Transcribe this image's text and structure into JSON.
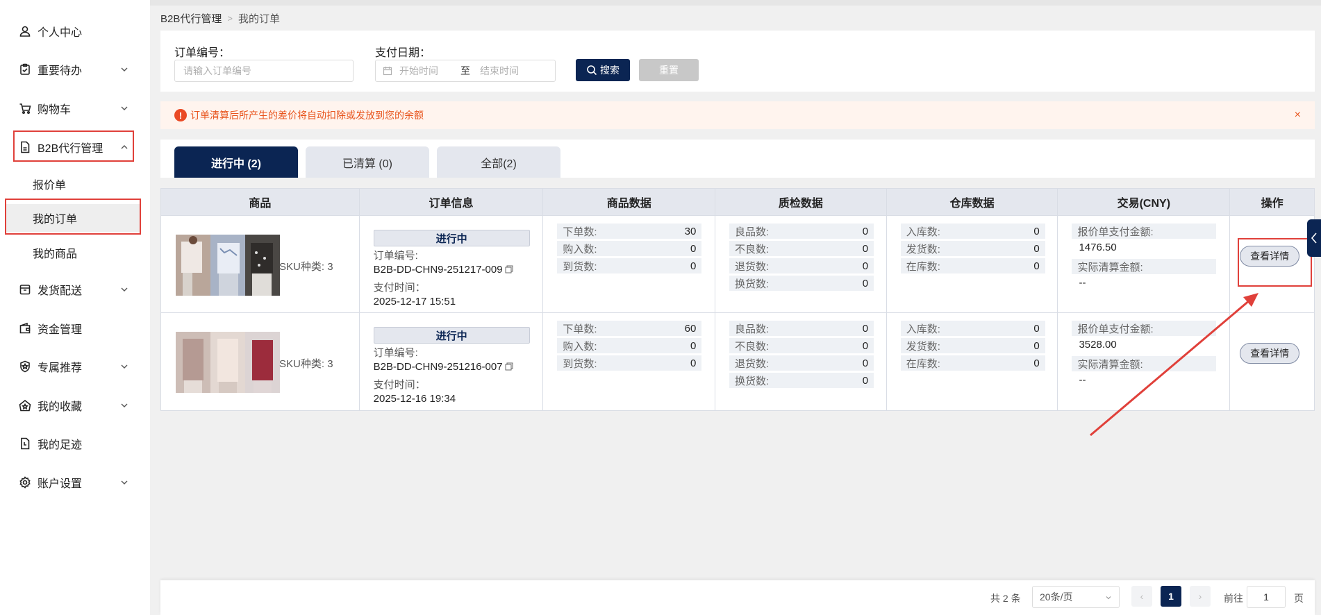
{
  "sidebar": {
    "items": [
      {
        "label": "个人中心",
        "icon": "user-icon"
      },
      {
        "label": "重要待办",
        "icon": "clipboard-icon"
      },
      {
        "label": "购物车",
        "icon": "cart-icon"
      },
      {
        "label": "B2B代行管理",
        "icon": "document-icon",
        "expanded": true,
        "children": [
          "报价单",
          "我的订单",
          "我的商品"
        ],
        "active_child": "我的订单"
      },
      {
        "label": "发货配送",
        "icon": "shipping-icon"
      },
      {
        "label": "资金管理",
        "icon": "wallet-icon"
      },
      {
        "label": "专属推荐",
        "icon": "badge-icon"
      },
      {
        "label": "我的收藏",
        "icon": "star-icon"
      },
      {
        "label": "我的足迹",
        "icon": "history-icon"
      },
      {
        "label": "账户设置",
        "icon": "gear-icon"
      }
    ]
  },
  "breadcrumb": {
    "parent": "B2B代行管理",
    "current": "我的订单"
  },
  "search": {
    "order_no_label": "订单编号：",
    "order_no_placeholder": "请输入订单编号",
    "pay_date_label": "支付日期：",
    "start_placeholder": "开始时间",
    "range_sep": "至",
    "end_placeholder": "结束时间",
    "search_btn": "搜索",
    "reset_btn": "重置"
  },
  "alert": {
    "text": "订单清算后所产生的差价将自动扣除或发放到您的余额",
    "close": "×"
  },
  "tabs": [
    {
      "label": "进行中 (2)",
      "active": true
    },
    {
      "label": "已清算 (0)",
      "active": false
    },
    {
      "label": "全部(2)",
      "active": false
    }
  ],
  "table": {
    "headers": [
      "商品",
      "订单信息",
      "商品数据",
      "质检数据",
      "仓库数据",
      "交易(CNY)",
      "操作"
    ],
    "labels": {
      "sku": "SKU种类:",
      "order_no": "订单编号:",
      "pay_time": "支付时间：",
      "goods": [
        "下单数:",
        "购入数:",
        "到货数:"
      ],
      "qc": [
        "良品数:",
        "不良数:",
        "退货数:",
        "换货数:"
      ],
      "warehouse": [
        "入库数:",
        "发货数:",
        "在库数:"
      ],
      "quote_amount": "报价单支付金额:",
      "settle_amount": "实际清算金额:",
      "detail_btn": "查看详情"
    },
    "rows": [
      {
        "sku_count": "3",
        "status": "进行中",
        "order_no": "B2B-DD-CHN9-251217-009",
        "pay_time": "2025-12-17 15:51",
        "goods": [
          "30",
          "0",
          "0"
        ],
        "qc": [
          "0",
          "0",
          "0",
          "0"
        ],
        "warehouse": [
          "0",
          "0",
          "0"
        ],
        "quote_amount": "1476.50",
        "settle_amount": "--"
      },
      {
        "sku_count": "3",
        "status": "进行中",
        "order_no": "B2B-DD-CHN9-251216-007",
        "pay_time": "2025-12-16 19:34",
        "goods": [
          "60",
          "0",
          "0"
        ],
        "qc": [
          "0",
          "0",
          "0",
          "0"
        ],
        "warehouse": [
          "0",
          "0",
          "0"
        ],
        "quote_amount": "3528.00",
        "settle_amount": "--"
      }
    ]
  },
  "pagination": {
    "total": "共 2 条",
    "page_size": "20条/页",
    "prev": "‹",
    "current": "1",
    "next": "›",
    "goto_label": "前往",
    "goto_value": "1",
    "page_suffix": "页"
  },
  "colors": {
    "primary": "#0b2553",
    "alert": "#e8551e",
    "annotation": "#e0403a"
  }
}
